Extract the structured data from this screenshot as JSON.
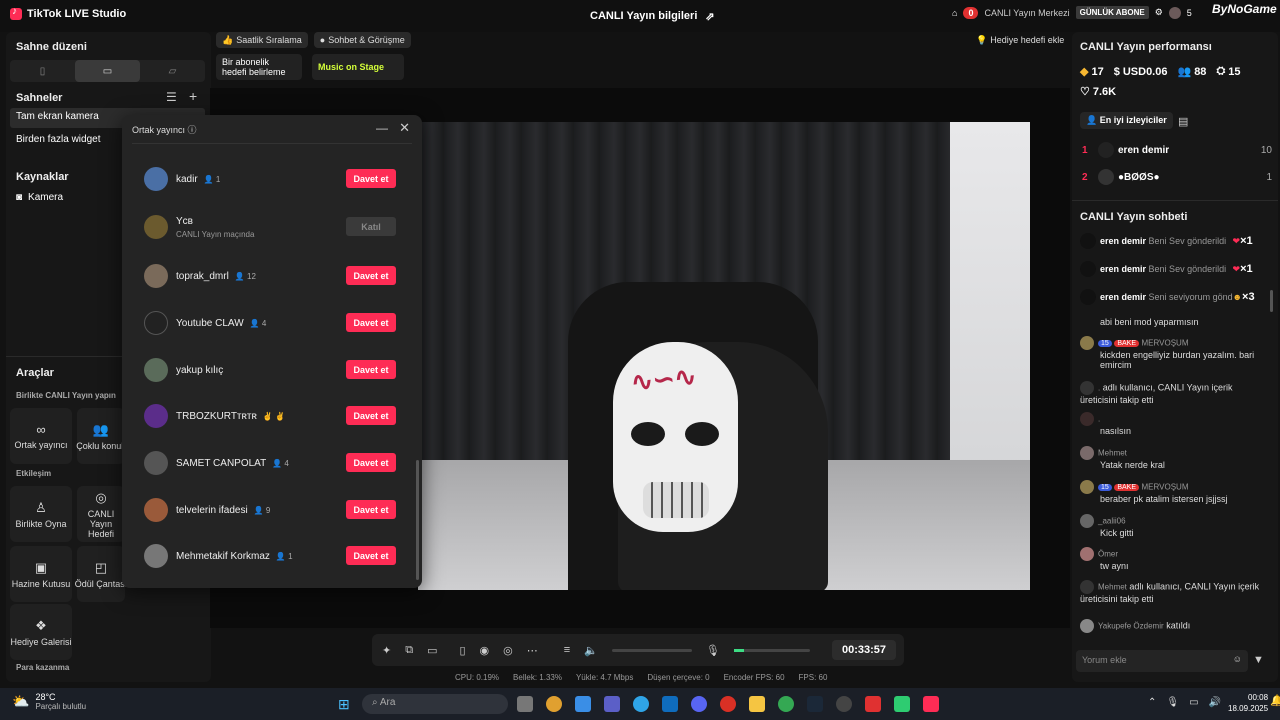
{
  "app": {
    "title": "TikTok LIVE Studio",
    "center_title": "CANLI Yayın bilgileri"
  },
  "top_right": {
    "notif_count": "0",
    "live_center": "CANLI Yayın Merkezi",
    "daily_sub": "GÜNLÜK ABONE",
    "count": "5",
    "brand": "ByNoGame"
  },
  "left": {
    "scene_layout": "Sahne düzeni",
    "scenes_header": "Sahneler",
    "scenes": [
      "Tam ekran kamera",
      "Birden fazla widget"
    ],
    "sources_header": "Kaynaklar",
    "sources": [
      "Kamera"
    ],
    "tools_header": "Araçlar",
    "together_header": "Birlikte CANLI Yayın yapın",
    "tools": [
      "Ortak yayıncı",
      "Çoklu konuk"
    ],
    "interaction_header": "Etkileşim",
    "interaction": [
      "Birlikte Oyna",
      "CANLI Yayın Hedefi",
      "Hazine Kutusu",
      "Ödül Çantası",
      "Hediye Galerisi"
    ],
    "earn_header": "Para kazanma"
  },
  "toptabs": {
    "tab1": "Saatlik Sıralama",
    "tab2": "Sohbet & Görüşme",
    "card1": "Bir abonelik hedefi belirleme",
    "card2": "Music on Stage",
    "gift_goal": "Hediye hedefi ekle"
  },
  "popup": {
    "title": "Ortak yayıncı",
    "rows": [
      {
        "name": "kadir",
        "count": "1",
        "btn": "Davet et",
        "color": "#4a6fa5"
      },
      {
        "name": "Yᴄʙ",
        "count": "",
        "sub": "CANLI Yayın maçında",
        "btn": "Katıl",
        "color": "#6b5a2e"
      },
      {
        "name": "toprak_dmrl",
        "count": "12",
        "btn": "Davet et",
        "color": "#7a6a5a"
      },
      {
        "name": "Youtube CLAW",
        "count": "4",
        "btn": "Davet et",
        "color": "#222222"
      },
      {
        "name": "yakup kılıç",
        "count": "",
        "btn": "Davet et",
        "color": "#5a6b5a"
      },
      {
        "name": "TRBOZKURTᴛʀᴛʀ",
        "count": "",
        "btn": "Davet et",
        "color": "#5b2d8a"
      },
      {
        "name": "SAMET CANPOLAT",
        "count": "4",
        "btn": "Davet et",
        "color": "#555555"
      },
      {
        "name": "telvelerin ifadesi",
        "count": "9",
        "btn": "Davet et",
        "color": "#9a5a3a"
      },
      {
        "name": "Mehmetakif Korkmaz",
        "count": "1",
        "btn": "Davet et",
        "color": "#777777"
      }
    ]
  },
  "right": {
    "perf_title": "CANLI Yayın performansı",
    "stats": {
      "diamonds": "17",
      "usd": "USD0.06",
      "viewers": "88",
      "new": "15",
      "likes": "7.6K"
    },
    "top_viewers_tab": "En iyi izleyiciler",
    "top_viewers": [
      {
        "rank": "1",
        "name": "eren demir",
        "score": "10"
      },
      {
        "rank": "2",
        "name": "●BØØS●",
        "score": "1"
      }
    ],
    "chat_title": "CANLI Yayın sohbeti",
    "gifts": [
      {
        "name": "eren demir",
        "text": "Beni Sev gönderildi",
        "mult": "×1"
      },
      {
        "name": "eren demir",
        "text": "Beni Sev gönderildi",
        "mult": "×1"
      },
      {
        "name": "eren demir",
        "text": "Seni seviyorum gönderildi",
        "mult": "×3"
      }
    ],
    "messages": [
      {
        "name": "",
        "text": "abi beni mod yaparmısın"
      },
      {
        "name": "MERVOŞUM",
        "badge1": "15",
        "badge2": "BAKE",
        "text": "kickden engelliyiz burdan yazalım. bari emircim"
      },
      {
        "name": ".",
        "text": "adlı kullanıcı, CANLI Yayın içerik üreticisini takip etti"
      },
      {
        "name": ".",
        "text": "nasılsın"
      },
      {
        "name": "Mehmet",
        "text": "Yatak nerde kral"
      },
      {
        "name": "MERVOŞUM",
        "badge1": "15",
        "badge2": "BAKE",
        "text": "beraber pk atalim istersen jsjjssj"
      },
      {
        "name": "_aalii06",
        "text": "Kick gitti"
      },
      {
        "name": "Ömer",
        "text": "tw aynı"
      },
      {
        "name": "Mehmet",
        "text": "adlı kullanıcı, CANLI Yayın içerik üreticisini takip etti"
      },
      {
        "name": "Yakupefe Özdemir",
        "text": "katıldı"
      }
    ],
    "comment_placeholder": "Yorum ekle"
  },
  "bottom": {
    "timer": "00:33:57"
  },
  "status": {
    "cpu": "CPU: 0.19%",
    "mem": "Bellek: 1.33%",
    "upload": "Yükle: 4.7 Mbps",
    "dropped": "Düşen çerçeve: 0",
    "enc_fps": "Encoder FPS: 60",
    "fps": "FPS: 60"
  },
  "taskbar": {
    "temp": "28°C",
    "weather": "Parçalı bulutlu",
    "search": "Ara",
    "time": "00:08",
    "date": "18.09.2025"
  }
}
